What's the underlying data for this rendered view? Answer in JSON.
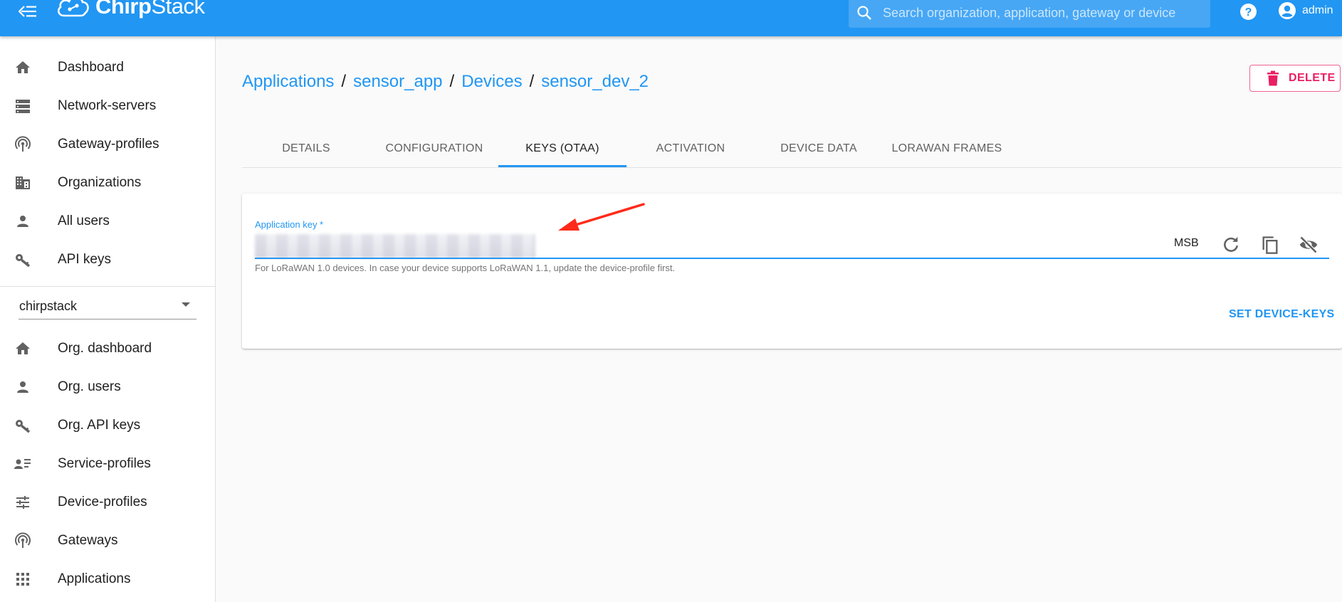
{
  "header": {
    "brand_chirp": "Chirp",
    "brand_stack": "Stack",
    "search_placeholder": "Search organization, application, gateway or device",
    "user_name": "admin"
  },
  "sidebar": {
    "admin_items": [
      {
        "label": "Dashboard",
        "icon": "home-icon"
      },
      {
        "label": "Network-servers",
        "icon": "server-icon"
      },
      {
        "label": "Gateway-profiles",
        "icon": "gateway-icon"
      },
      {
        "label": "Organizations",
        "icon": "building-icon"
      },
      {
        "label": "All users",
        "icon": "person-icon"
      },
      {
        "label": "API keys",
        "icon": "key-icon"
      }
    ],
    "org_select_value": "chirpstack",
    "org_items": [
      {
        "label": "Org. dashboard",
        "icon": "home-icon"
      },
      {
        "label": "Org. users",
        "icon": "person-icon"
      },
      {
        "label": "Org. API keys",
        "icon": "key-icon"
      },
      {
        "label": "Service-profiles",
        "icon": "service-profile-icon"
      },
      {
        "label": "Device-profiles",
        "icon": "tune-icon"
      },
      {
        "label": "Gateways",
        "icon": "gateway-icon"
      },
      {
        "label": "Applications",
        "icon": "apps-icon"
      }
    ]
  },
  "breadcrumb": [
    "Applications",
    "sensor_app",
    "Devices",
    "sensor_dev_2"
  ],
  "delete_label": "DELETE",
  "tabs": [
    "DETAILS",
    "CONFIGURATION",
    "KEYS (OTAA)",
    "ACTIVATION",
    "DEVICE DATA",
    "LORAWAN FRAMES"
  ],
  "active_tab": "KEYS (OTAA)",
  "keys_form": {
    "label": "Application key *",
    "byte_order": "MSB",
    "helper": "For LoRaWAN 1.0 devices. In case your device supports LoRaWAN 1.1, update the device-profile first.",
    "submit_label": "SET DEVICE-KEYS"
  },
  "colors": {
    "primary": "#2196f3",
    "danger": "#e91e63",
    "annotation": "#ff2a1a"
  }
}
